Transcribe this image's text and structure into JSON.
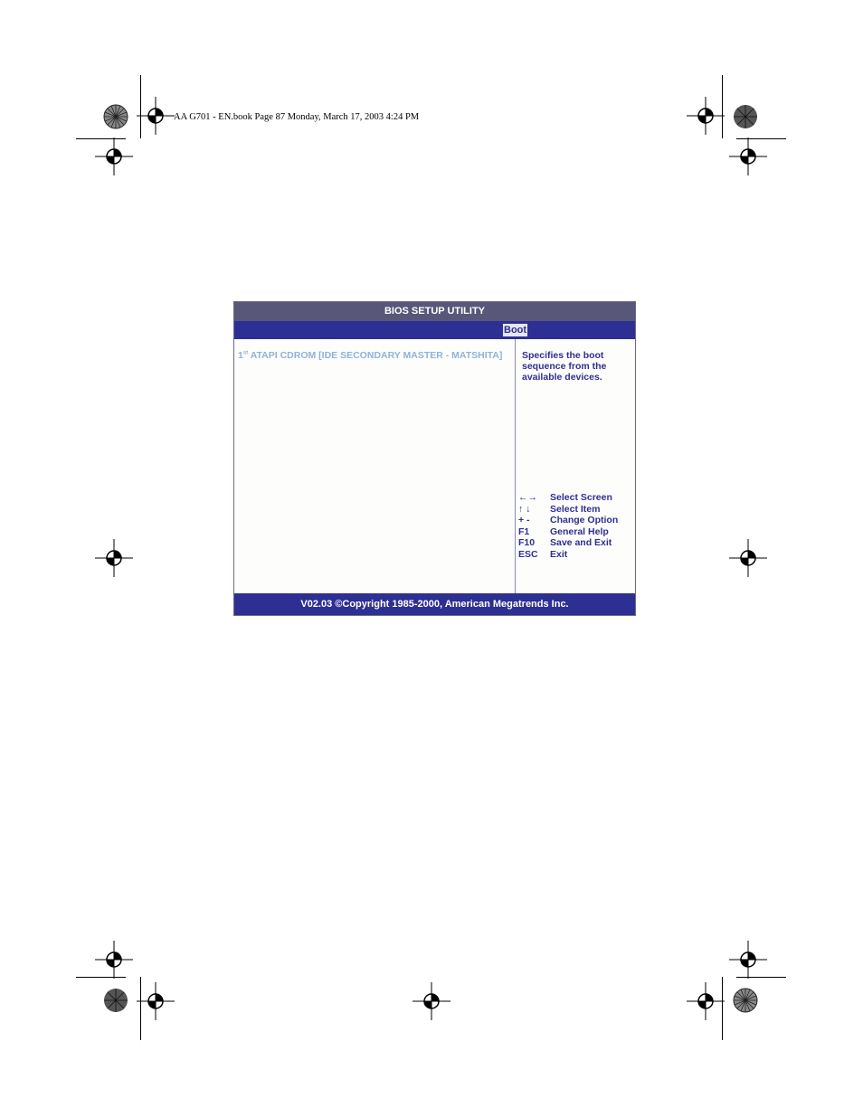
{
  "page_header": "AA G701 - EN.book  Page 87  Monday, March 17, 2003  4:24 PM",
  "bios": {
    "title": "BIOS SETUP UTILITY",
    "active_tab": "Boot",
    "boot_item": {
      "ordinal": "1",
      "ordinal_suffix": "st",
      "label": " ATAPI CDROM  [IDE SECONDARY MASTER - MATSHITA]"
    },
    "help_text": "Specifies the boot sequence from the available devices.",
    "key_legend": [
      {
        "key": "←→",
        "desc": "Select Screen"
      },
      {
        "key": "↑ ↓",
        "desc": "Select Item"
      },
      {
        "key": "+ -",
        "desc": "Change Option"
      },
      {
        "key": "F1",
        "desc": "General Help"
      },
      {
        "key": "F10",
        "desc": "Save and Exit"
      },
      {
        "key": "ESC",
        "desc": "Exit"
      }
    ],
    "footer": "V02.03 ©Copyright 1985-2000, American Megatrends Inc."
  },
  "colors": {
    "title_bar": "#58577a",
    "tab_bar": "#2e2f92",
    "item_text": "#8fb3d9",
    "help_text": "#2e2f92"
  }
}
